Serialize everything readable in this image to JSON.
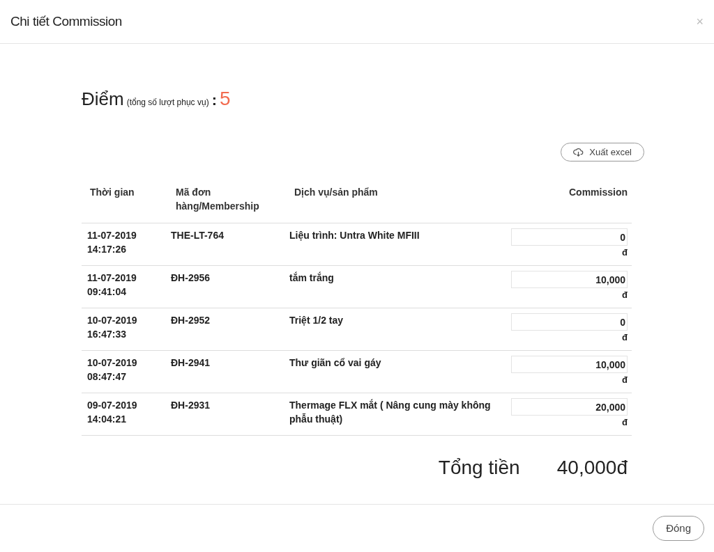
{
  "dialog": {
    "title": "Chi tiết Commission",
    "close": "×"
  },
  "score": {
    "label": "Điểm",
    "note": "(tổng số lượt phục vụ)",
    "separator": ":",
    "value": "5"
  },
  "export_button": "Xuất excel",
  "table": {
    "columns": [
      "Thời gian",
      "Mã đơn hàng/Membership",
      "Dịch vụ/sản phẩm",
      "Commission"
    ],
    "rows": [
      {
        "date": "11-07-2019",
        "time": "14:17:26",
        "code": "THE-LT-764",
        "service": "Liệu trình: Untra White MFIII",
        "commission": "0",
        "currency": "đ"
      },
      {
        "date": "11-07-2019",
        "time": "09:41:04",
        "code": "ĐH-2956",
        "service": "tắm trắng",
        "commission": "10,000",
        "currency": "đ"
      },
      {
        "date": "10-07-2019",
        "time": "16:47:33",
        "code": "ĐH-2952",
        "service": "Triệt 1/2 tay",
        "commission": "0",
        "currency": "đ"
      },
      {
        "date": "10-07-2019",
        "time": "08:47:47",
        "code": "ĐH-2941",
        "service": "Thư giãn cổ vai gáy",
        "commission": "10,000",
        "currency": "đ"
      },
      {
        "date": "09-07-2019",
        "time": "14:04:21",
        "code": "ĐH-2931",
        "service": "Thermage FLX mắt ( Nâng cung mày không phẫu thuật)",
        "commission": "20,000",
        "currency": "đ"
      }
    ]
  },
  "total": {
    "label": "Tổng tiền",
    "value": "40,000đ"
  },
  "footer_button": "Đóng"
}
